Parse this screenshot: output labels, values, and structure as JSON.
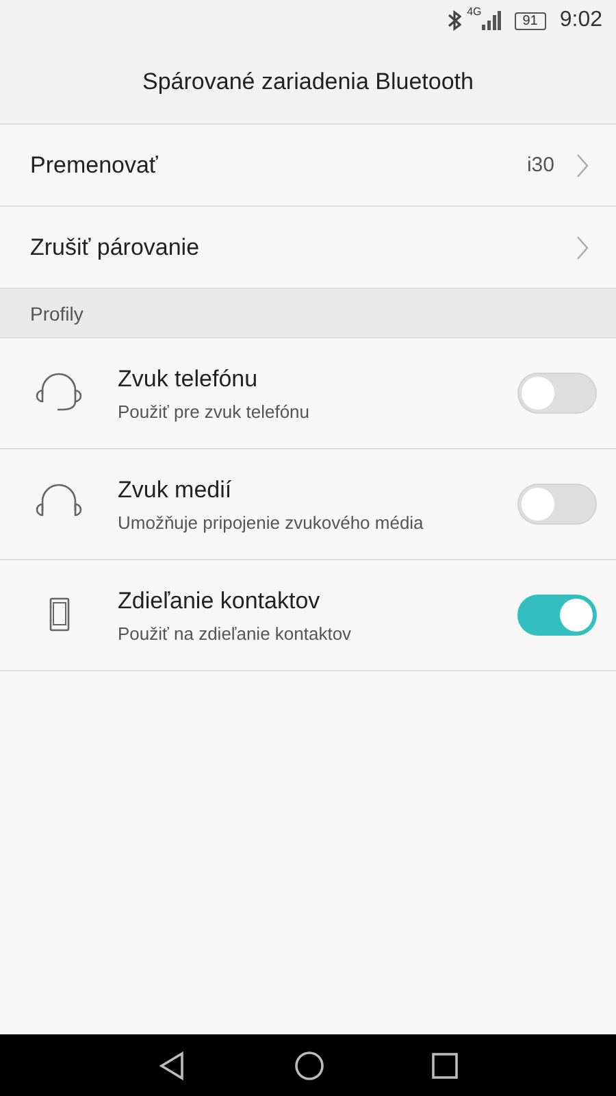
{
  "status_bar": {
    "network": "4G",
    "battery": "91",
    "time": "9:02"
  },
  "title": "Spárované zariadenia Bluetooth",
  "actions": [
    {
      "label": "Premenovať",
      "value": "i30"
    },
    {
      "label": "Zrušiť párovanie"
    }
  ],
  "section": "Profily",
  "profiles": [
    {
      "kind": "headset",
      "name": "Zvuk telefónu",
      "description": "Použiť pre zvuk telefónu",
      "on": false
    },
    {
      "kind": "headphones",
      "name": "Zvuk medií",
      "description": "Umožňuje pripojenie zvukového média",
      "on": false
    },
    {
      "kind": "phone",
      "name": "Zdieľanie kontaktov",
      "description": "Použiť na zdieľanie kontaktov",
      "on": true
    }
  ]
}
